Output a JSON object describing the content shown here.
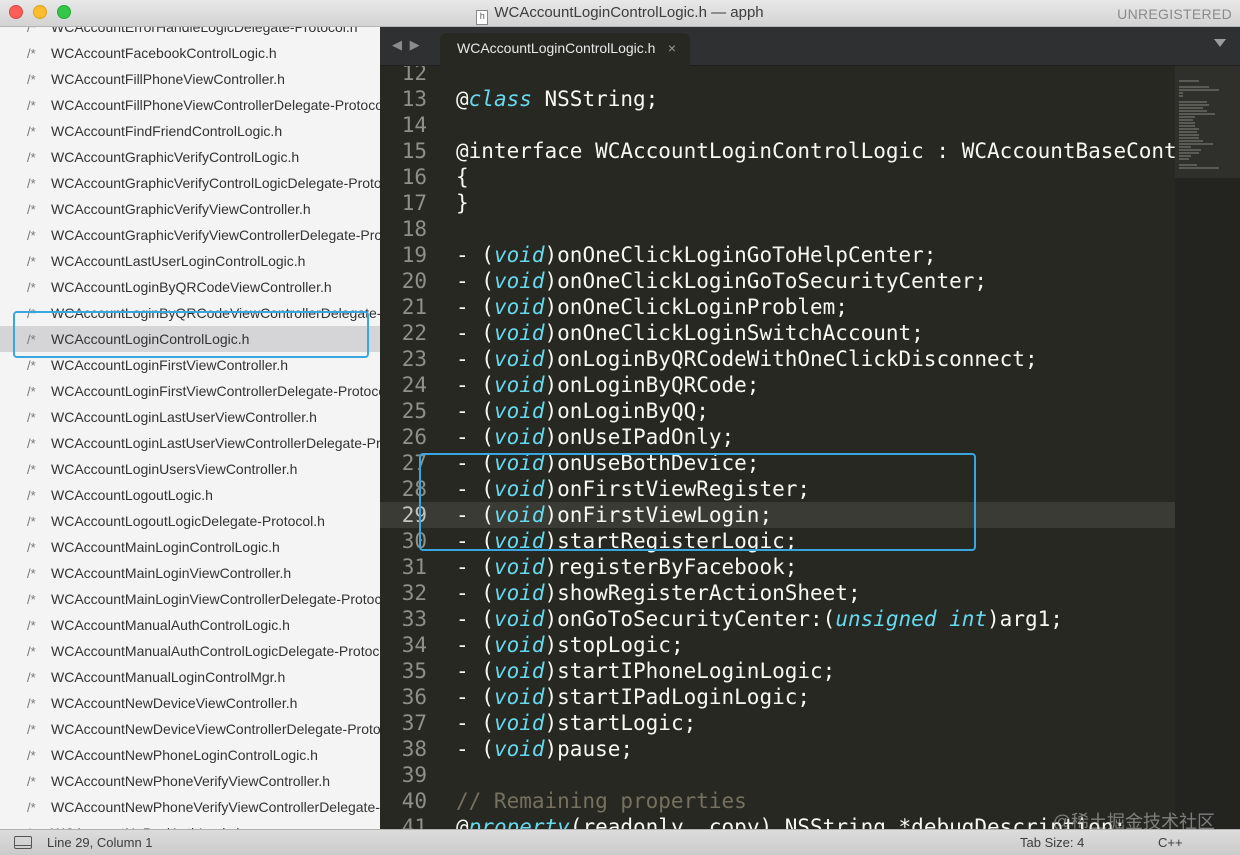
{
  "window": {
    "title": "WCAccountLoginControlLogic.h — apph",
    "doc_icon": "h",
    "registration": "UNREGISTERED"
  },
  "sidebar": {
    "item_icon": "/*",
    "items": [
      {
        "label": "WCAccountErrorHandleLogicDelegate-Protocol.h"
      },
      {
        "label": "WCAccountFacebookControlLogic.h"
      },
      {
        "label": "WCAccountFillPhoneViewController.h"
      },
      {
        "label": "WCAccountFillPhoneViewControllerDelegate-Protocol.h"
      },
      {
        "label": "WCAccountFindFriendControlLogic.h"
      },
      {
        "label": "WCAccountGraphicVerifyControlLogic.h"
      },
      {
        "label": "WCAccountGraphicVerifyControlLogicDelegate-Protocol.h"
      },
      {
        "label": "WCAccountGraphicVerifyViewController.h"
      },
      {
        "label": "WCAccountGraphicVerifyViewControllerDelegate-Protocol.h"
      },
      {
        "label": "WCAccountLastUserLoginControlLogic.h"
      },
      {
        "label": "WCAccountLoginByQRCodeViewController.h"
      },
      {
        "label": "WCAccountLoginByQRCodeViewControllerDelegate-Protocol.h"
      },
      {
        "label": "WCAccountLoginControlLogic.h",
        "selected": true
      },
      {
        "label": "WCAccountLoginFirstViewController.h"
      },
      {
        "label": "WCAccountLoginFirstViewControllerDelegate-Protocol.h"
      },
      {
        "label": "WCAccountLoginLastUserViewController.h"
      },
      {
        "label": "WCAccountLoginLastUserViewControllerDelegate-Protocol.h"
      },
      {
        "label": "WCAccountLoginUsersViewController.h"
      },
      {
        "label": "WCAccountLogoutLogic.h"
      },
      {
        "label": "WCAccountLogoutLogicDelegate-Protocol.h"
      },
      {
        "label": "WCAccountMainLoginControlLogic.h"
      },
      {
        "label": "WCAccountMainLoginViewController.h"
      },
      {
        "label": "WCAccountMainLoginViewControllerDelegate-Protocol.h"
      },
      {
        "label": "WCAccountManualAuthControlLogic.h"
      },
      {
        "label": "WCAccountManualAuthControlLogicDelegate-Protocol.h"
      },
      {
        "label": "WCAccountManualLoginControlMgr.h"
      },
      {
        "label": "WCAccountNewDeviceViewController.h"
      },
      {
        "label": "WCAccountNewDeviceViewControllerDelegate-Protocol.h"
      },
      {
        "label": "WCAccountNewPhoneLoginControlLogic.h"
      },
      {
        "label": "WCAccountNewPhoneVerifyViewController.h"
      },
      {
        "label": "WCAccountNewPhoneVerifyViewControllerDelegate-Protocol.h"
      },
      {
        "label": "WCAccountNoPwdAuthLogic.h"
      }
    ]
  },
  "tabs": {
    "nav": "◀ ▶",
    "active_label": "WCAccountLoginControlLogic.h",
    "close_glyph": "×"
  },
  "editor": {
    "current_line": 29,
    "lines": [
      {
        "n": "12",
        "segs": []
      },
      {
        "n": "13",
        "segs": [
          {
            "t": "@",
            "c": ""
          },
          {
            "t": "class",
            "c": "kw"
          },
          {
            "t": " NSString;",
            "c": ""
          }
        ]
      },
      {
        "n": "14",
        "segs": []
      },
      {
        "n": "15",
        "segs": [
          {
            "t": "@interface WCAccountLoginControlLogic : WCAccountBaseControlLogic",
            "c": ""
          }
        ]
      },
      {
        "n": "16",
        "segs": [
          {
            "t": "{",
            "c": ""
          }
        ]
      },
      {
        "n": "17",
        "segs": [
          {
            "t": "}",
            "c": ""
          }
        ]
      },
      {
        "n": "18",
        "segs": []
      },
      {
        "n": "19",
        "segs": [
          {
            "t": "- (",
            "c": ""
          },
          {
            "t": "void",
            "c": "kw"
          },
          {
            "t": ")onOneClickLoginGoToHelpCenter;",
            "c": ""
          }
        ]
      },
      {
        "n": "20",
        "segs": [
          {
            "t": "- (",
            "c": ""
          },
          {
            "t": "void",
            "c": "kw"
          },
          {
            "t": ")onOneClickLoginGoToSecurityCenter;",
            "c": ""
          }
        ]
      },
      {
        "n": "21",
        "segs": [
          {
            "t": "- (",
            "c": ""
          },
          {
            "t": "void",
            "c": "kw"
          },
          {
            "t": ")onOneClickLoginProblem;",
            "c": ""
          }
        ]
      },
      {
        "n": "22",
        "segs": [
          {
            "t": "- (",
            "c": ""
          },
          {
            "t": "void",
            "c": "kw"
          },
          {
            "t": ")onOneClickLoginSwitchAccount;",
            "c": ""
          }
        ]
      },
      {
        "n": "23",
        "segs": [
          {
            "t": "- (",
            "c": ""
          },
          {
            "t": "void",
            "c": "kw"
          },
          {
            "t": ")onLoginByQRCodeWithOneClickDisconnect;",
            "c": ""
          }
        ]
      },
      {
        "n": "24",
        "segs": [
          {
            "t": "- (",
            "c": ""
          },
          {
            "t": "void",
            "c": "kw"
          },
          {
            "t": ")onLoginByQRCode;",
            "c": ""
          }
        ]
      },
      {
        "n": "25",
        "segs": [
          {
            "t": "- (",
            "c": ""
          },
          {
            "t": "void",
            "c": "kw"
          },
          {
            "t": ")onLoginByQQ;",
            "c": ""
          }
        ]
      },
      {
        "n": "26",
        "segs": [
          {
            "t": "- (",
            "c": ""
          },
          {
            "t": "void",
            "c": "kw"
          },
          {
            "t": ")onUseIPadOnly;",
            "c": ""
          }
        ]
      },
      {
        "n": "27",
        "segs": [
          {
            "t": "- (",
            "c": ""
          },
          {
            "t": "void",
            "c": "kw"
          },
          {
            "t": ")onUseBothDevice;",
            "c": ""
          }
        ]
      },
      {
        "n": "28",
        "segs": [
          {
            "t": "- (",
            "c": ""
          },
          {
            "t": "void",
            "c": "kw"
          },
          {
            "t": ")onFirstViewRegister;",
            "c": ""
          }
        ]
      },
      {
        "n": "29",
        "segs": [
          {
            "t": "- (",
            "c": ""
          },
          {
            "t": "void",
            "c": "kw"
          },
          {
            "t": ")onFirstViewLogin;",
            "c": ""
          }
        ]
      },
      {
        "n": "30",
        "segs": [
          {
            "t": "- (",
            "c": ""
          },
          {
            "t": "void",
            "c": "kw"
          },
          {
            "t": ")startRegisterLogic;",
            "c": ""
          }
        ]
      },
      {
        "n": "31",
        "segs": [
          {
            "t": "- (",
            "c": ""
          },
          {
            "t": "void",
            "c": "kw"
          },
          {
            "t": ")registerByFacebook;",
            "c": ""
          }
        ]
      },
      {
        "n": "32",
        "segs": [
          {
            "t": "- (",
            "c": ""
          },
          {
            "t": "void",
            "c": "kw"
          },
          {
            "t": ")showRegisterActionSheet;",
            "c": ""
          }
        ]
      },
      {
        "n": "33",
        "segs": [
          {
            "t": "- (",
            "c": ""
          },
          {
            "t": "void",
            "c": "kw"
          },
          {
            "t": ")onGoToSecurityCenter:(",
            "c": ""
          },
          {
            "t": "unsigned int",
            "c": "kw"
          },
          {
            "t": ")arg1;",
            "c": ""
          }
        ]
      },
      {
        "n": "34",
        "segs": [
          {
            "t": "- (",
            "c": ""
          },
          {
            "t": "void",
            "c": "kw"
          },
          {
            "t": ")stopLogic;",
            "c": ""
          }
        ]
      },
      {
        "n": "35",
        "segs": [
          {
            "t": "- (",
            "c": ""
          },
          {
            "t": "void",
            "c": "kw"
          },
          {
            "t": ")startIPhoneLoginLogic;",
            "c": ""
          }
        ]
      },
      {
        "n": "36",
        "segs": [
          {
            "t": "- (",
            "c": ""
          },
          {
            "t": "void",
            "c": "kw"
          },
          {
            "t": ")startIPadLoginLogic;",
            "c": ""
          }
        ]
      },
      {
        "n": "37",
        "segs": [
          {
            "t": "- (",
            "c": ""
          },
          {
            "t": "void",
            "c": "kw"
          },
          {
            "t": ")startLogic;",
            "c": ""
          }
        ]
      },
      {
        "n": "38",
        "segs": [
          {
            "t": "- (",
            "c": ""
          },
          {
            "t": "void",
            "c": "kw"
          },
          {
            "t": ")pause;",
            "c": ""
          }
        ]
      },
      {
        "n": "39",
        "segs": []
      },
      {
        "n": "40",
        "segs": [
          {
            "t": "// Remaining properties",
            "c": "cm"
          }
        ]
      },
      {
        "n": "41",
        "segs": [
          {
            "t": "@",
            "c": ""
          },
          {
            "t": "property",
            "c": "kw"
          },
          {
            "t": "(readonly, copy) NSString *debugDescription;",
            "c": ""
          }
        ]
      }
    ]
  },
  "watermark": "@稀土掘金技术社区",
  "status": {
    "position": "Line 29, Column 1",
    "tab_size": "Tab Size: 4",
    "syntax": "C++"
  },
  "colors": {
    "editor_bg": "#272822",
    "keyword": "#66d9ef",
    "comment": "#75715e",
    "annotation_box": "#3aa6e0"
  }
}
